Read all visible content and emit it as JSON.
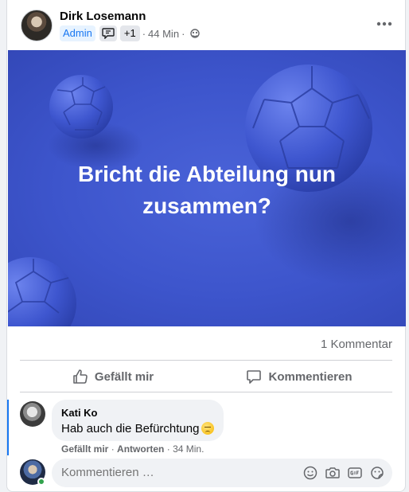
{
  "post": {
    "author": "Dirk Losemann",
    "role_badge": "Admin",
    "extra_badges": "+1",
    "separator": "·",
    "time": "44 Min",
    "more_label": "•••",
    "headline_line1": "Bricht die Abteilung nun",
    "headline_line2": "zusammen?",
    "comment_count": "1 Kommentar"
  },
  "actions": {
    "like": "Gefällt mir",
    "comment": "Kommentieren"
  },
  "comment": {
    "author": "Kati Ko",
    "text": "Hab auch die Befürchtung",
    "like": "Gefällt mir",
    "sep": "·",
    "reply": "Antworten",
    "time": "34 Min."
  },
  "composer": {
    "placeholder": "Kommentieren …"
  },
  "icons": {
    "audience": "group-globe-icon",
    "like": "thumbs-up-icon",
    "comment": "comment-bubble-icon",
    "emoji": "smiley-icon",
    "camera": "camera-icon",
    "gif": "gif-icon",
    "sticker": "sticker-icon"
  },
  "colors": {
    "accent": "#1877f2",
    "image_bg": "#3d55cc",
    "online": "#31a24c"
  }
}
